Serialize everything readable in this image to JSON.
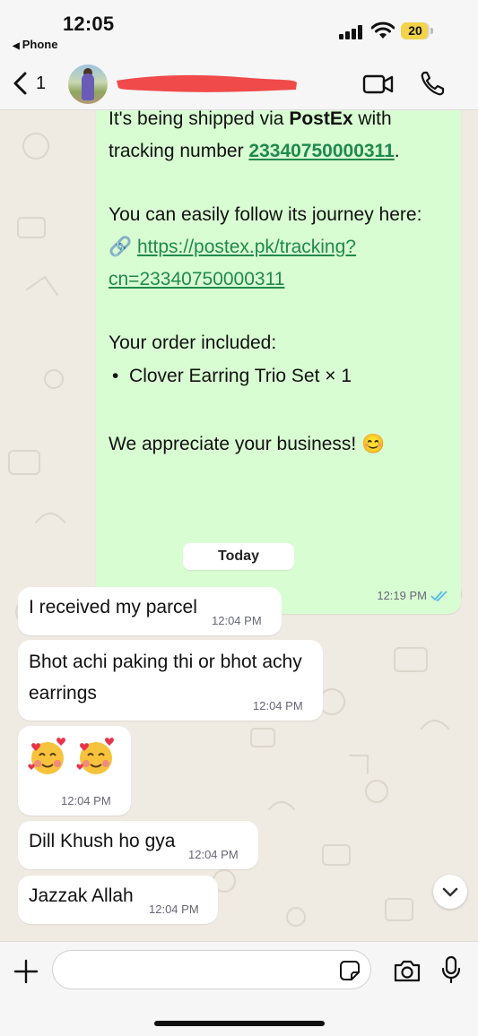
{
  "status_bar": {
    "time": "12:05",
    "back_app": "Phone",
    "battery": "20",
    "battery_color": "#f2d34a"
  },
  "header": {
    "unread_count": "1",
    "contact_name_redacted": true,
    "icons": [
      "back-chevron-icon",
      "video-call-icon",
      "phone-call-icon"
    ]
  },
  "messages": {
    "outgoing": {
      "line1_pre": "It's being shipped via ",
      "line1_bold": "PostEx",
      "line1_post": " with",
      "line2_pre": "tracking number ",
      "tracking_number": "23340750000311",
      "line2_post": ".",
      "line3": "You can easily follow its journey here:",
      "link_emoji": "🔗",
      "link_line1": "https://postex.pk/tracking?",
      "link_line2": "cn=23340750000311",
      "line4": "Your order included:",
      "item_bullet": "•",
      "item": "Clover Earring Trio Set × 1",
      "line5": "We appreciate your business! 😊",
      "time": "12:19 PM",
      "status": "read"
    },
    "date_chip": "Today",
    "incoming": [
      {
        "text": "I received my parcel",
        "time": "12:04 PM"
      },
      {
        "text_line1": "Bhot achi paking thi or bhot achy",
        "text_line2": "earrings",
        "time": "12:04 PM"
      },
      {
        "emoji_count": 2,
        "emoji_name": "smiling-face-with-hearts",
        "time": "12:04 PM"
      },
      {
        "text": "Dill Khush ho gya",
        "time": "12:04 PM"
      },
      {
        "text": "Jazzak Allah",
        "time": "12:04 PM"
      }
    ]
  },
  "composer": {
    "placeholder": "",
    "icons": [
      "plus-icon",
      "sticker-icon",
      "camera-icon",
      "microphone-icon"
    ]
  },
  "colors": {
    "outgoing_bubble": "#d9fdd3",
    "incoming_bubble": "#ffffff",
    "chat_background": "#efeae2",
    "link": "#1f8a4c",
    "read_ticks": "#53bdeb"
  }
}
